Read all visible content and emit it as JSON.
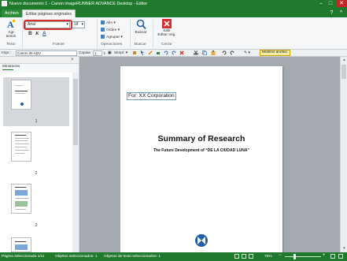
{
  "window": {
    "title": "Nuevo documento 1 - Canon imageRUNNER ADVANCE Desktop - Editor",
    "controls": {
      "minimize": "–",
      "maximize": "□",
      "close": "✕"
    }
  },
  "menubar": {
    "file_tab": "Archivo",
    "active_tab": "Editar páginas originales",
    "help": "?",
    "pin": "^"
  },
  "ribbon": {
    "add_text_label_1": "Agr",
    "add_text_label_2": "textos",
    "font_name": "Arial",
    "font_size": "18",
    "format_bold": "B",
    "format_italic": "K",
    "format_color": "A",
    "align_label": "Alin",
    "order_label": "Orden",
    "group_label": "Agrupar",
    "search_label": "Buscar",
    "exit_label_1": "Salir",
    "exit_label_2": "Editar orig.",
    "groups": {
      "text": "Texto",
      "font": "Fuente",
      "operations": "Operaciones",
      "search": "Buscar",
      "close": "Cerrar"
    }
  },
  "toolbar2": {
    "print_label": "Impr.:",
    "printer_value": "Canon iR-ADV",
    "copies_label": "Copias",
    "copies_value": "1",
    "mode_value": "Simpl.",
    "show_annotations": "Mostrar anotac."
  },
  "left_pane": {
    "close": "×",
    "title": "Miniaturas",
    "pages": [
      "1",
      "2",
      "3"
    ]
  },
  "document": {
    "for_text": "For: XX Corporation",
    "title": "Summary of Research",
    "subtitle": "The Future Development of “DE LA CIUDAD LUNA”"
  },
  "statusbar": {
    "selected_page": "Página seleccionada 1/11",
    "selected_objects": "Objetos seleccionados: 1",
    "selected_text_objects": "Objetos de texto seleccionados: 1",
    "zoom": "75%"
  }
}
